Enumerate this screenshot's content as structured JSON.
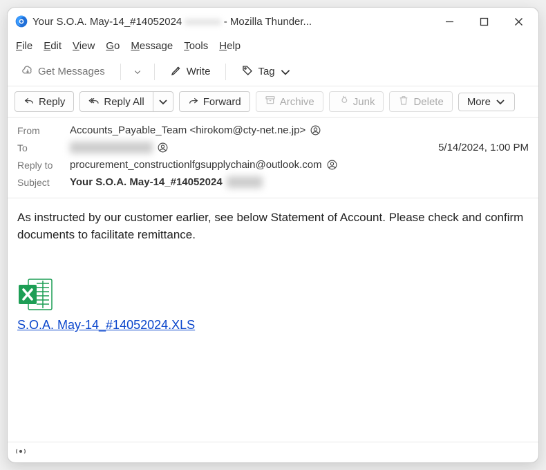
{
  "window": {
    "title_prefix": "Your S.O.A. May-14_#14052024",
    "title_redacted": "xxxxxxx",
    "title_suffix": " - Mozilla Thunder..."
  },
  "menubar": {
    "file": "File",
    "edit": "Edit",
    "view": "View",
    "go": "Go",
    "message": "Message",
    "tools": "Tools",
    "help": "Help"
  },
  "toolbar1": {
    "get_messages": "Get Messages",
    "write": "Write",
    "tag": "Tag"
  },
  "toolbar2": {
    "reply": "Reply",
    "reply_all": "Reply All",
    "forward": "Forward",
    "archive": "Archive",
    "junk": "Junk",
    "delete": "Delete",
    "more": "More"
  },
  "headers": {
    "from_label": "From",
    "from_value": "Accounts_Payable_Team <hirokom@cty-net.ne.jp>",
    "to_label": "To",
    "to_redacted": "xxxxxxxxxxxxxxxx",
    "date": "5/14/2024, 1:00 PM",
    "replyto_label": "Reply to",
    "replyto_value": "procurement_constructionlfgsupplychain@outlook.com",
    "subject_label": "Subject",
    "subject_value": "Your S.O.A. May-14_#14052024",
    "subject_redacted": "xxxxxxx"
  },
  "body": {
    "text": "As instructed by our customer earlier, see below Statement of Account. Please check and confirm documents to facilitate remittance.",
    "attachment_name": "S.O.A. May-14_#14052024.XLS"
  },
  "status": {
    "indicator": "((o))"
  }
}
